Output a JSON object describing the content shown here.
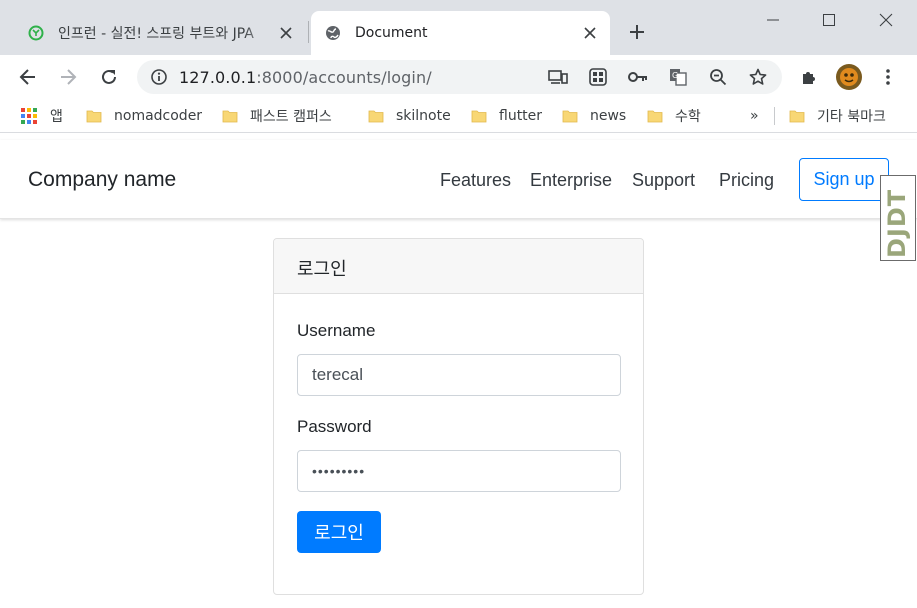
{
  "browser": {
    "tabs": [
      {
        "title": "인프런 - 실전! 스프링 부트와 JPA",
        "active": false,
        "favicon": "inflearn-icon"
      },
      {
        "title": "Document",
        "active": true,
        "favicon": "globe-icon"
      }
    ],
    "url": {
      "host": "127.0.0.1",
      "path": ":8000/accounts/login/"
    },
    "bookmarks": [
      {
        "label": "앱",
        "icon": "apps-grid-icon"
      },
      {
        "label": "nomadcoder",
        "icon": "folder-icon"
      },
      {
        "label": "패스트 캠퍼스",
        "icon": "folder-icon"
      },
      {
        "label": "skilnote",
        "icon": "folder-icon"
      },
      {
        "label": "flutter",
        "icon": "folder-icon"
      },
      {
        "label": "news",
        "icon": "folder-icon"
      },
      {
        "label": "수학",
        "icon": "folder-icon"
      },
      {
        "label": "기타 북마크",
        "icon": "folder-icon"
      }
    ],
    "overflow_label": "»",
    "colors": {
      "chrome_bg": "#dee1e6",
      "folder": "#f8d775"
    }
  },
  "navbar": {
    "brand": "Company name",
    "links": [
      "Features",
      "Enterprise",
      "Support",
      "Pricing"
    ],
    "signup_label": "Sign up",
    "colors": {
      "primary": "#007bff"
    }
  },
  "extension_badge": {
    "label": "DJDT"
  },
  "login_card": {
    "title": "로그인",
    "username_label": "Username",
    "username_value": "terecal",
    "password_label": "Password",
    "password_value": "•••••••••",
    "submit_label": "로그인"
  }
}
